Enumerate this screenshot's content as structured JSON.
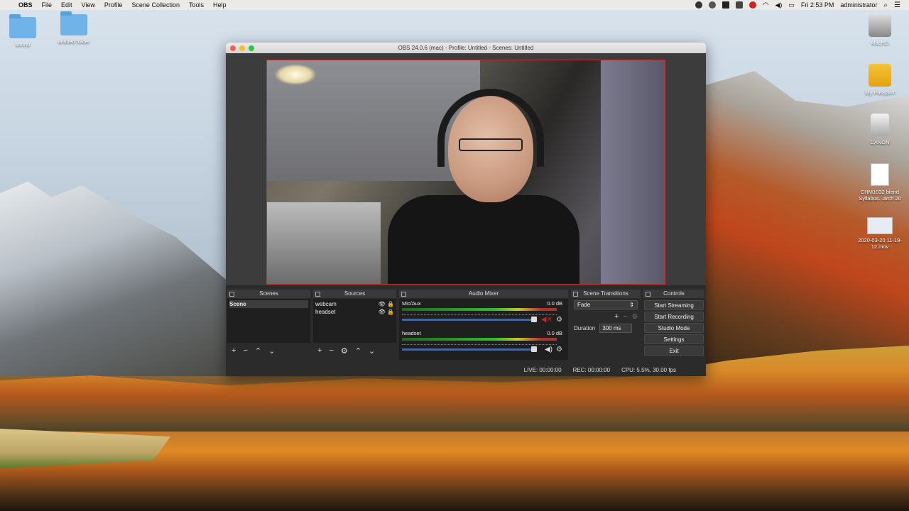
{
  "menubar": {
    "app": "OBS",
    "items": [
      "File",
      "Edit",
      "View",
      "Profile",
      "Scene Collection",
      "Tools",
      "Help"
    ],
    "clock": "Fri 2:53 PM",
    "user": "administrator"
  },
  "desktop": {
    "icons_left": [
      {
        "label": "sound",
        "icon": "folder-icon"
      },
      {
        "label": "untitled folder",
        "icon": "folder-icon"
      }
    ],
    "icons_right": [
      {
        "label": "MacHD",
        "icon": "hard-drive-icon"
      },
      {
        "label": "My Passport",
        "icon": "external-drive-icon"
      },
      {
        "label": "CANON",
        "icon": "sd-card-icon"
      },
      {
        "label": "CHM1032 blend Syllabus...arch 20",
        "icon": "docx-icon"
      },
      {
        "label": "2020-03-20 11-19-12.mov",
        "icon": "movie-file-icon"
      }
    ]
  },
  "window": {
    "title": "OBS 24.0.6 (mac) - Profile: Untitled - Scenes: Untitled"
  },
  "scenes": {
    "header": "Scenes",
    "items": [
      "Scene"
    ]
  },
  "sources": {
    "header": "Sources",
    "items": [
      "webcam",
      "headset"
    ]
  },
  "mixer": {
    "header": "Audio Mixer",
    "channels": [
      {
        "name": "Mic/Aux",
        "level": "0.0 dB",
        "muted": true
      },
      {
        "name": "headset",
        "level": "0.0 dB",
        "muted": false
      }
    ]
  },
  "transitions": {
    "header": "Scene Transitions",
    "selected": "Fade",
    "duration_label": "Duration",
    "duration_value": "300 ms"
  },
  "controls": {
    "header": "Controls",
    "buttons": [
      "Start Streaming",
      "Start Recording",
      "Studio Mode",
      "Settings",
      "Exit"
    ]
  },
  "status": {
    "live": "LIVE: 00:00:00",
    "rec": "REC: 00:00:00",
    "cpu": "CPU: 5.5%, 30.00 fps"
  },
  "colors": {
    "accent_blue": "#2a6bd0",
    "preview_border": "#c03030",
    "mute_red": "#d02020"
  }
}
